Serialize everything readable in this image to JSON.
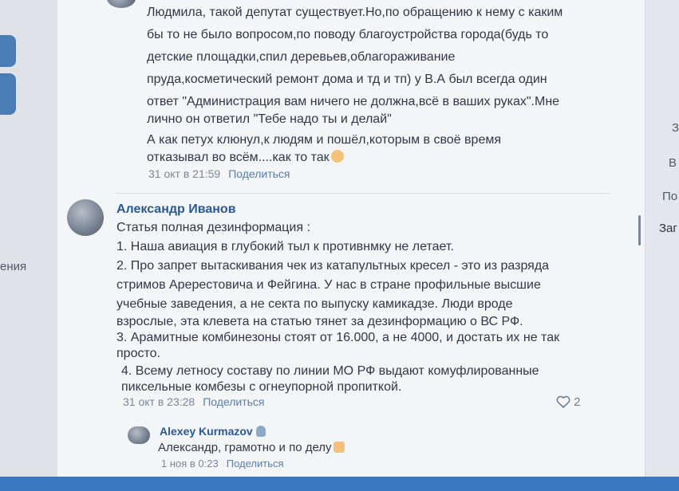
{
  "comment1": {
    "lines": [
      "Людмила, такой депутат существует.Но,по обращению к нему с каким",
      "бы то не было вопросом,по поводу благоустройства города(будь то",
      "детские площадки,спил деревьев,облагораживание",
      "пруда,косметический ремонт дома и тд и тп) у В.А был всегда один",
      "ответ \"Администрация вам ничего не должна,всё в ваших руках\".Мне",
      "лично он ответил \"Тебе надо ты и делай\"",
      "А как петух клюнул,к людям и пошёл,которым в своё время",
      "отказывал во всём....как то так"
    ],
    "date": "31 окт в 21:59",
    "share": "Поделиться"
  },
  "comment2": {
    "author": "Александр Иванов",
    "lines": [
      "Статья полная дезинформация :",
      "1. Наша авиация в глубокий тыл к противнмку не летает.",
      "2. Про запрет вытаскивания чек из катапультных кресел - это из разряда",
      "стримов Аререстовича и Фейгина. У нас в стране профильные высшие",
      "учебные заведения, а не секта по выпуску камикадзе. Люди вроде",
      "взрослые, эта клевета на статью тянет за дезинформацию о ВС РФ.",
      "3. Арамитные комбинезоны стоят от 16.000, а не 4000, и достать их не так",
      "просто.",
      "4. Всему летносу составу по линии МО РФ выдают комуфлированные",
      "пиксельные комбезы с огнеупорной пропиткой."
    ],
    "date": "31 окт в 23:28",
    "share": "Поделиться",
    "likes": "2"
  },
  "reply": {
    "author": "Alexey Kurmazov",
    "text": "Александр, грамотно и по делу",
    "date": "1 ноя в 0:23",
    "share": "Поделиться"
  },
  "left_nav": {
    "label": "ения"
  },
  "right_nav": {
    "items": [
      "З",
      "В",
      "По",
      "Заг"
    ]
  }
}
